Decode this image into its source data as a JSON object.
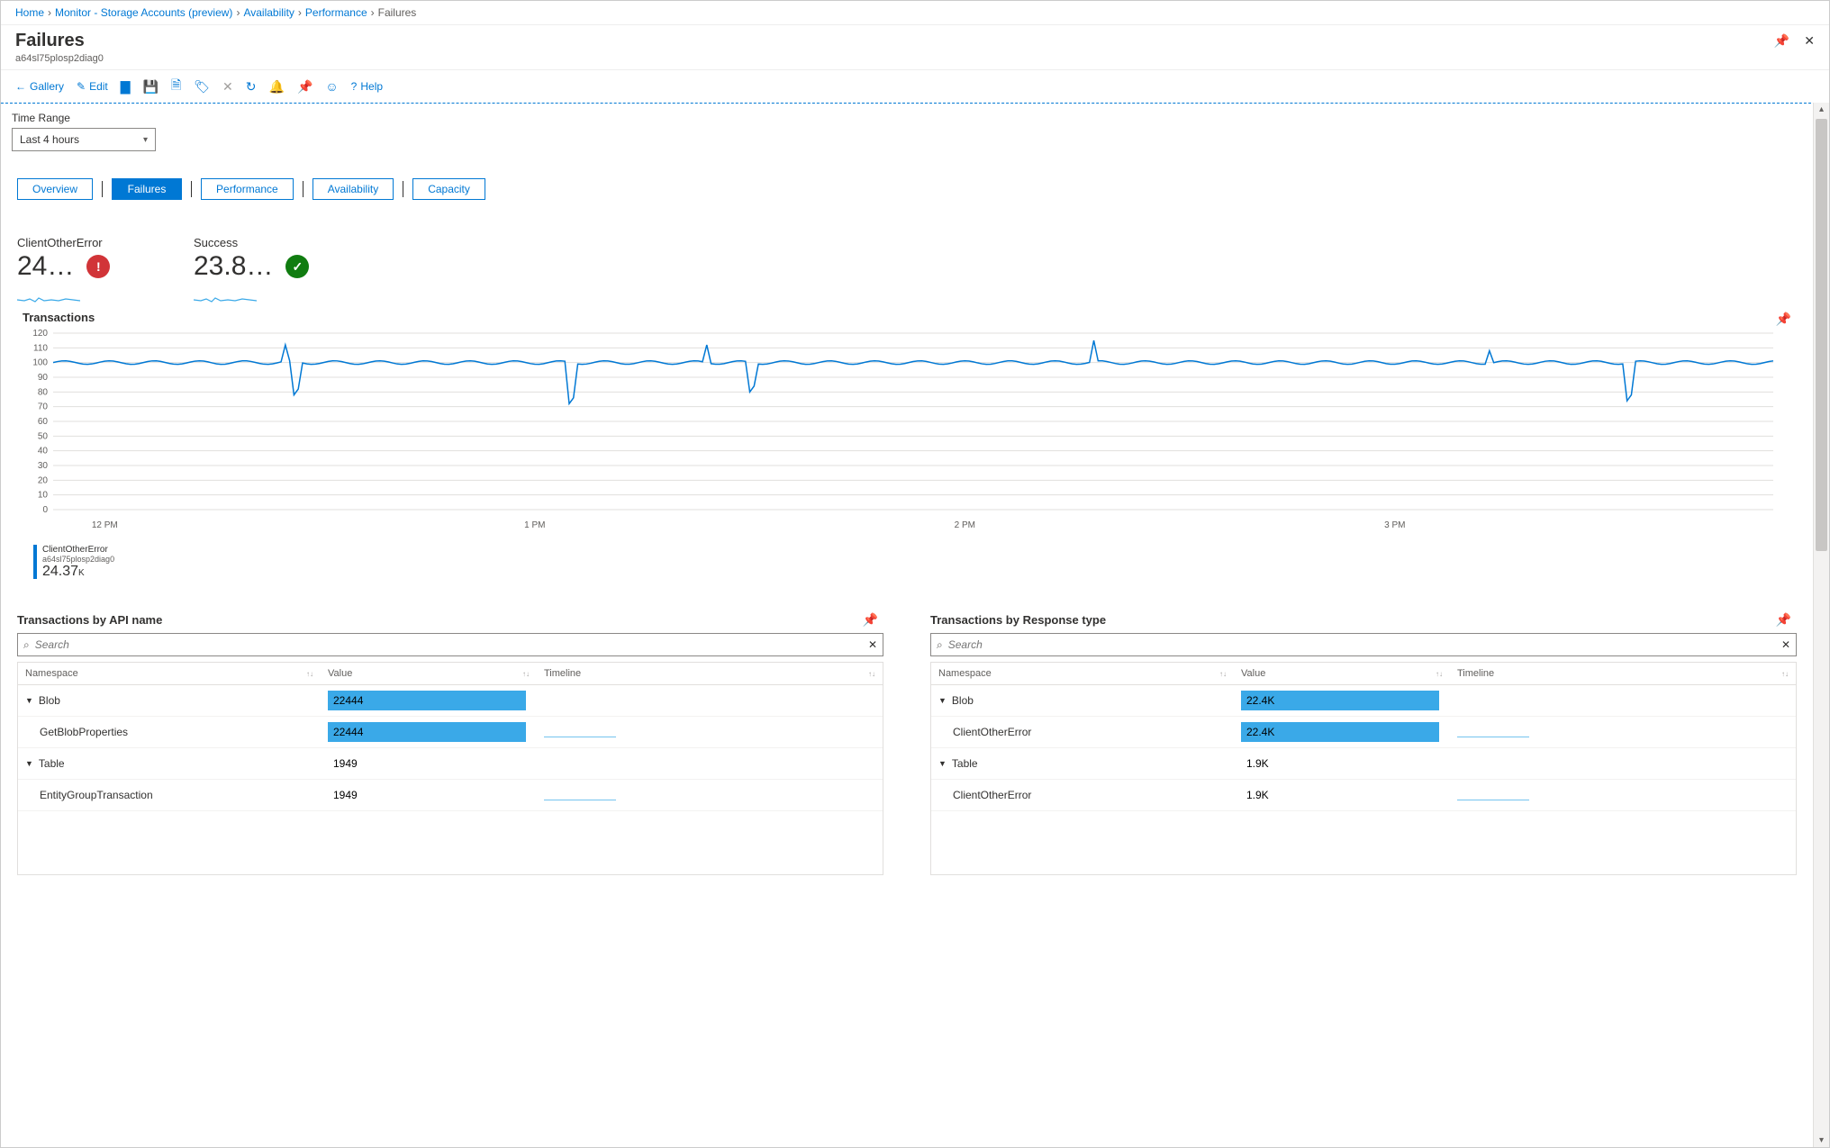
{
  "breadcrumb": [
    {
      "label": "Home",
      "link": true
    },
    {
      "label": "Monitor - Storage Accounts (preview)",
      "link": true
    },
    {
      "label": "Availability",
      "link": true
    },
    {
      "label": "Performance",
      "link": true
    },
    {
      "label": "Failures",
      "link": false
    }
  ],
  "page": {
    "title": "Failures",
    "subtitle": "a64sl75plosp2diag0"
  },
  "toolbar": {
    "gallery": "Gallery",
    "edit": "Edit",
    "help": "Help"
  },
  "timerange": {
    "label": "Time Range",
    "value": "Last 4 hours"
  },
  "tabs": [
    "Overview",
    "Failures",
    "Performance",
    "Availability",
    "Capacity"
  ],
  "active_tab": 1,
  "kpis": [
    {
      "name": "ClientOtherError",
      "value": "24…",
      "status": "error"
    },
    {
      "name": "Success",
      "value": "23.8…",
      "status": "ok"
    }
  ],
  "transactions_title": "Transactions",
  "chart_data": {
    "type": "line",
    "ylabel": "",
    "ylim": [
      0,
      120
    ],
    "yticks": [
      0,
      10,
      20,
      30,
      40,
      50,
      60,
      70,
      80,
      90,
      100,
      110,
      120
    ],
    "xticks": [
      "12 PM",
      "1 PM",
      "2 PM",
      "3 PM"
    ],
    "series": [
      {
        "name": "ClientOtherError",
        "values_baseline": 100,
        "dips": [
          {
            "x": 0.14,
            "y": 78
          },
          {
            "x": 0.3,
            "y": 72
          },
          {
            "x": 0.405,
            "y": 80
          },
          {
            "x": 0.915,
            "y": 74
          }
        ],
        "spikes": [
          {
            "x": 0.135,
            "y": 112
          },
          {
            "x": 0.38,
            "y": 112
          },
          {
            "x": 0.605,
            "y": 115
          },
          {
            "x": 0.835,
            "y": 108
          }
        ]
      }
    ],
    "legend": {
      "name": "ClientOtherError",
      "source": "a64sl75plosp2diag0",
      "value": "24.37",
      "unit": "K"
    }
  },
  "tables": {
    "api": {
      "title": "Transactions by API name",
      "search_placeholder": "Search",
      "columns": [
        "Namespace",
        "Value",
        "Timeline"
      ],
      "rows": [
        {
          "ns": "Blob",
          "indent": 0,
          "expand": true,
          "value": "22444",
          "bar": true,
          "timeline": false
        },
        {
          "ns": "GetBlobProperties",
          "indent": 1,
          "value": "22444",
          "bar": true,
          "timeline": true
        },
        {
          "ns": "Table",
          "indent": 0,
          "expand": true,
          "value": "1949",
          "bar": false,
          "timeline": false
        },
        {
          "ns": "EntityGroupTransaction",
          "indent": 1,
          "value": "1949",
          "bar": false,
          "timeline": true
        }
      ]
    },
    "resp": {
      "title": "Transactions by Response type",
      "search_placeholder": "Search",
      "columns": [
        "Namespace",
        "Value",
        "Timeline"
      ],
      "rows": [
        {
          "ns": "Blob",
          "indent": 0,
          "expand": true,
          "value": "22.4K",
          "bar": true,
          "timeline": false
        },
        {
          "ns": "ClientOtherError",
          "indent": 1,
          "value": "22.4K",
          "bar": true,
          "timeline": true
        },
        {
          "ns": "Table",
          "indent": 0,
          "expand": true,
          "value": "1.9K",
          "bar": false,
          "timeline": false
        },
        {
          "ns": "ClientOtherError",
          "indent": 1,
          "value": "1.9K",
          "bar": false,
          "timeline": true
        }
      ]
    }
  }
}
